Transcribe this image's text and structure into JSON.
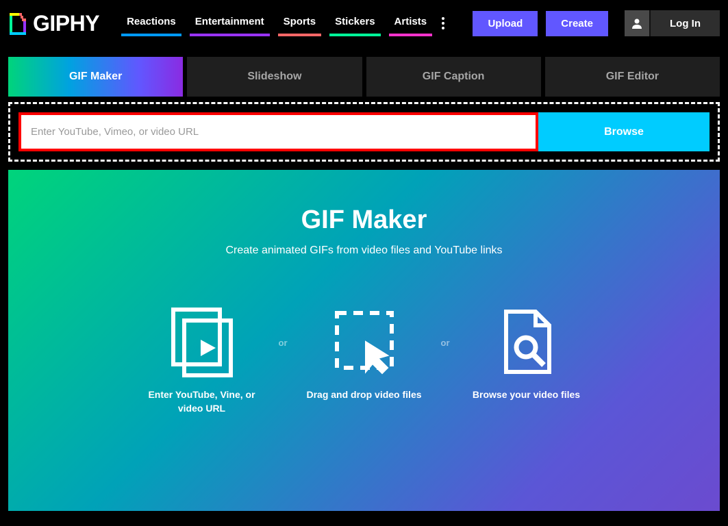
{
  "logo": {
    "text": "GIPHY"
  },
  "nav": {
    "items": [
      "Reactions",
      "Entertainment",
      "Sports",
      "Stickers",
      "Artists"
    ]
  },
  "buttons": {
    "upload": "Upload",
    "create": "Create",
    "login": "Log In"
  },
  "tabs": {
    "items": [
      "GIF Maker",
      "Slideshow",
      "GIF Caption",
      "GIF Editor"
    ],
    "active": 0
  },
  "url_row": {
    "placeholder": "Enter YouTube, Vimeo, or video URL",
    "browse": "Browse"
  },
  "hero": {
    "title": "GIF Maker",
    "subtitle": "Create animated GIFs from video files and YouTube links",
    "or": "or",
    "methods": [
      "Enter YouTube, Vine, or video URL",
      "Drag and drop video files",
      "Browse your video files"
    ]
  }
}
